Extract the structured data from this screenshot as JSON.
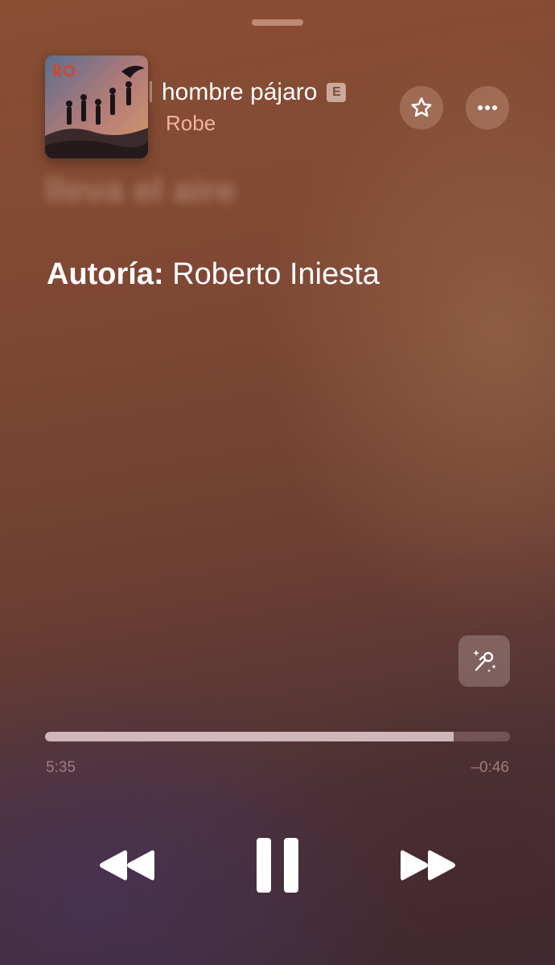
{
  "track": {
    "title": "hombre pájaro",
    "explicit_badge": "E",
    "artist": "Robe"
  },
  "lyrics": {
    "faded_line": "lleva el aire",
    "credits_label": "Autoría:",
    "credits_value": "Roberto Iniesta"
  },
  "playback": {
    "elapsed": "5:35",
    "remaining": "–0:46",
    "progress_fraction": 0.879
  },
  "icons": {
    "favorite": "star-icon",
    "more": "ellipsis-icon",
    "lyrics": "microphone-sparkles-icon",
    "previous": "rewind-icon",
    "play_pause": "pause-icon",
    "next": "fast-forward-icon"
  },
  "colors": {
    "artist_text": "#f5b9a0",
    "progress_fill": "#e1c8cd"
  }
}
